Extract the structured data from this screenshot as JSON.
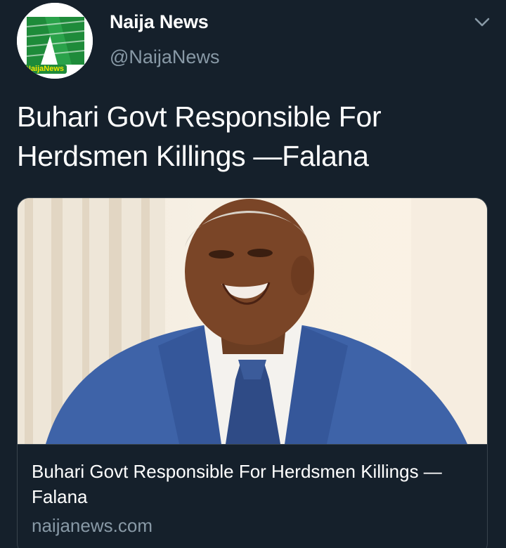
{
  "author": {
    "display_name": "Naija News",
    "handle": "@NaijaNews",
    "avatar_label": "NaijaNews"
  },
  "tweet": {
    "text": "Buhari Govt Responsible For Herdsmen Killings —Falana"
  },
  "card": {
    "title": "Buhari Govt Responsible For Herdsmen Killings —Falana",
    "domain": "naijanews.com"
  },
  "icons": {
    "more": "chevron-down-icon"
  },
  "colors": {
    "background": "#15202b",
    "secondary_text": "#8899a6",
    "border": "#38444d",
    "brand_green": "#1e8b3a"
  }
}
